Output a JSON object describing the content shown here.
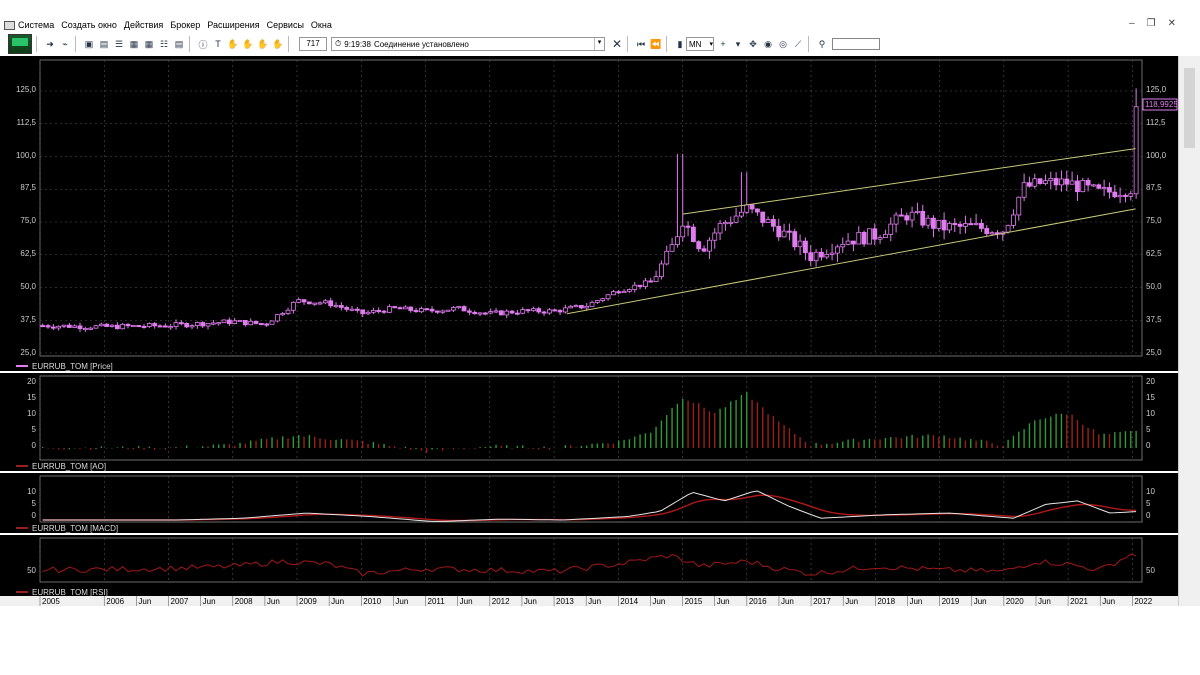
{
  "menu": {
    "items": [
      "Система",
      "Создать окно",
      "Действия",
      "Брокер",
      "Расширения",
      "Сервисы",
      "Окна"
    ]
  },
  "toolbar": {
    "count": "717",
    "status_time": "9:19:38",
    "status_text": "Соединение установлено",
    "timeframe": "MN",
    "icons": [
      "pointer-icon",
      "chart-icon",
      "window-icon",
      "table-icon",
      "list-icon",
      "info-icon",
      "text-icon",
      "hand-icon",
      "close-icon",
      "first-icon",
      "prev-icon",
      "bars-icon",
      "crosshair-icon",
      "move-icon",
      "target-icon",
      "ruler-icon",
      "search-icon"
    ]
  },
  "colors": {
    "background": "#000000",
    "candle": "#e07cf0",
    "trend": "#c8c879",
    "bull": "#2e9a38",
    "bear": "#9a2020",
    "macd": "#e6e6e6",
    "signal": "#b01818",
    "rsi": "#a01818"
  },
  "panels": {
    "price": {
      "legend": "EURRUB_TOM [Price]",
      "yticks": [
        "125,0",
        "112,5",
        "100,0",
        "87,5",
        "75,0",
        "62,5",
        "50,0",
        "37,5",
        "25,0"
      ],
      "last_value": "118,9925"
    },
    "ao": {
      "legend": "EURRUB_TOM [AO]",
      "yticks": [
        "20",
        "15",
        "10",
        "5",
        "0"
      ]
    },
    "macd": {
      "legend": "EURRUB_TOM [MACD]",
      "yticks": [
        "10",
        "5",
        "0"
      ]
    },
    "rsi": {
      "legend": "EURRUB_TOM [RSI]",
      "yticks": [
        "50"
      ]
    }
  },
  "timeline": {
    "labels": [
      "2005",
      "2006",
      "Jun",
      "2007",
      "Jun",
      "2008",
      "Jun",
      "2009",
      "Jun",
      "2010",
      "Jun",
      "2011",
      "Jun",
      "2012",
      "Jun",
      "2013",
      "Jun",
      "2014",
      "Jun",
      "2015",
      "Jun",
      "2016",
      "Jun",
      "2017",
      "Jun",
      "2018",
      "Jun",
      "2019",
      "Jun",
      "2020",
      "Jun",
      "2021",
      "Jun",
      "2022"
    ]
  },
  "chart_data": {
    "type": "line",
    "x_start": "2005",
    "x_end": "2022",
    "series": [
      {
        "name": "EURRUB_TOM [Price]",
        "x": [
          2005.0,
          2006.0,
          2007.0,
          2008.0,
          2008.5,
          2008.9,
          2009.0,
          2009.5,
          2010.0,
          2010.5,
          2011.0,
          2011.5,
          2012.0,
          2012.5,
          2013.0,
          2013.5,
          2014.0,
          2014.5,
          2014.8,
          2015.0,
          2015.3,
          2015.6,
          2016.0,
          2016.5,
          2017.0,
          2017.5,
          2018.0,
          2018.5,
          2019.0,
          2019.5,
          2020.0,
          2020.3,
          2020.6,
          2021.0,
          2021.5,
          2022.0,
          2022.1
        ],
        "values": [
          35.5,
          35,
          35.5,
          37,
          36,
          43,
          45,
          44,
          40,
          42,
          41,
          42,
          40,
          41,
          41,
          43,
          49,
          52,
          63,
          76,
          65,
          74,
          80,
          72,
          62,
          68,
          70,
          78,
          73,
          73,
          72,
          88,
          90,
          90,
          86,
          88,
          118.99
        ]
      },
      {
        "name": "EURRUB_TOM [AO]",
        "x": [
          2005.0,
          2007.0,
          2008.0,
          2009.0,
          2010.0,
          2011.0,
          2012.0,
          2013.0,
          2014.0,
          2014.5,
          2015.0,
          2015.5,
          2016.0,
          2016.5,
          2017.0,
          2018.0,
          2019.0,
          2020.0,
          2020.5,
          2021.0,
          2021.5,
          2022.0
        ],
        "values": [
          0,
          0,
          1,
          4,
          2,
          -1,
          0.5,
          0,
          2,
          5,
          16,
          11,
          17,
          8,
          1,
          3,
          4,
          1,
          9,
          11,
          4,
          5
        ]
      },
      {
        "name": "EURRUB_TOM [RSI]",
        "x": [
          2005.0,
          2007.0,
          2008.0,
          2008.8,
          2009.5,
          2010.0,
          2011.0,
          2012.0,
          2013.0,
          2014.0,
          2014.8,
          2015.3,
          2016.0,
          2016.5,
          2017.0,
          2018.0,
          2019.0,
          2020.0,
          2020.5,
          2021.0,
          2021.5,
          2022.0
        ],
        "values": [
          50,
          52,
          55,
          62,
          58,
          45,
          52,
          50,
          48,
          58,
          70,
          55,
          62,
          52,
          45,
          55,
          50,
          48,
          62,
          58,
          50,
          72
        ]
      }
    ]
  }
}
